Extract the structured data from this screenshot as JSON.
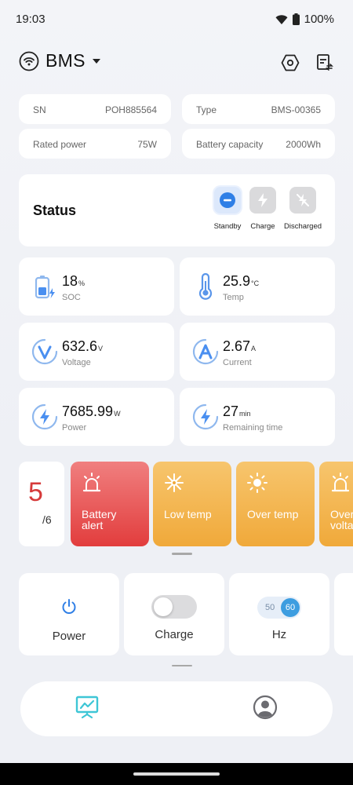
{
  "status_bar": {
    "time": "19:03",
    "battery": "100%"
  },
  "header": {
    "title": "BMS"
  },
  "info": [
    {
      "label": "SN",
      "value": "POH885564"
    },
    {
      "label": "Type",
      "value": "BMS-00365"
    },
    {
      "label": "Rated power",
      "value": "75W"
    },
    {
      "label": "Battery capacity",
      "value": "2000Wh"
    }
  ],
  "status": {
    "title": "Status",
    "modes": [
      {
        "label": "Standby",
        "active": true
      },
      {
        "label": "Charge",
        "active": false
      },
      {
        "label": "Discharged",
        "active": false
      }
    ]
  },
  "metrics": [
    {
      "value": "18",
      "unit": "%",
      "label": "SOC",
      "icon": "battery-charging-icon"
    },
    {
      "value": "25.9",
      "unit": "°C",
      "label": "Temp",
      "icon": "thermometer-icon"
    },
    {
      "value": "632.6",
      "unit": "V",
      "label": "Voltage",
      "icon": "voltage-icon"
    },
    {
      "value": "2.67",
      "unit": "A",
      "label": "Current",
      "icon": "current-icon"
    },
    {
      "value": "7685.99",
      "unit": "W",
      "label": "Power",
      "icon": "power-bolt-icon"
    },
    {
      "value": "27",
      "unit": "min",
      "label": "Remaining time",
      "icon": "bolt-time-icon"
    }
  ],
  "alerts": {
    "count": "5",
    "total": "/6",
    "items": [
      {
        "label": "Battery\nalert",
        "color": "#e23d3d",
        "icon": "alarm-light-icon"
      },
      {
        "label": "Low temp",
        "color": "#f0a93a",
        "icon": "snowflake-icon"
      },
      {
        "label": "Over temp",
        "color": "#f0a93a",
        "icon": "sun-icon"
      },
      {
        "label": "Over\nvolta",
        "color": "#f0a93a",
        "icon": "alarm-light-icon"
      }
    ]
  },
  "controls": {
    "power": {
      "label": "Power"
    },
    "charge": {
      "label": "Charge",
      "on": false
    },
    "hz": {
      "label": "Hz",
      "off": "50",
      "on": "60"
    }
  },
  "tabs": [
    {
      "name": "dashboard",
      "icon": "monitor-chart-icon",
      "active": true
    },
    {
      "name": "profile",
      "icon": "user-icon",
      "active": false
    }
  ],
  "colors": {
    "accent": "#3d9de0",
    "alert_red": "#e23d3d",
    "alert_orange": "#f0a93a"
  }
}
